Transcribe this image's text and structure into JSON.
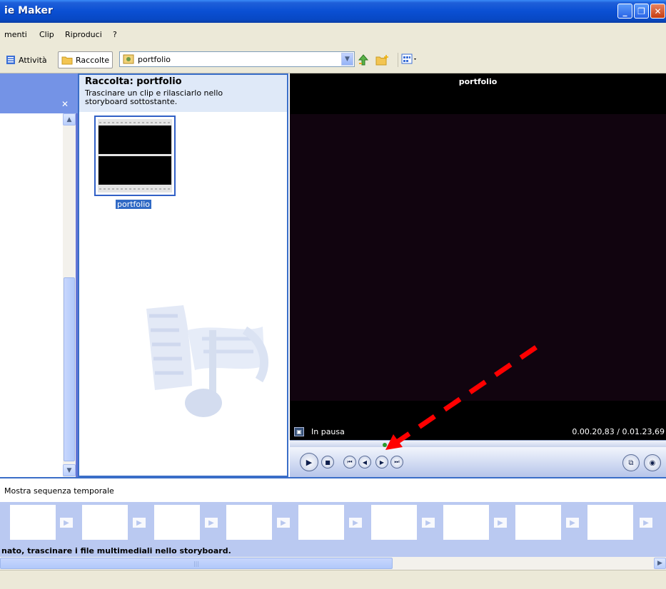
{
  "window": {
    "title": "ie Maker"
  },
  "menu": {
    "items": [
      "menti",
      "Clip",
      "Riproduci",
      "?"
    ]
  },
  "toolbar": {
    "tasks_label": "Attività",
    "collections_label": "Raccolte",
    "collection_value": "portfolio"
  },
  "collection": {
    "title": "Raccolta: portfolio",
    "description": "Trascinare un clip e rilasciarlo nello storyboard sottostante.",
    "clip_name": "portfolio"
  },
  "preview": {
    "title": "portfolio",
    "status": "In pausa",
    "time": "0.00.20,83 / 0.01.23,69",
    "position_fraction": 0.25
  },
  "storyboard": {
    "toggle_label": "Mostra sequenza temporale",
    "hint": "nato, trascinare i file multimediali nello storyboard."
  },
  "colors": {
    "accent": "#3a6ec8",
    "annotation": "#ff0000"
  }
}
